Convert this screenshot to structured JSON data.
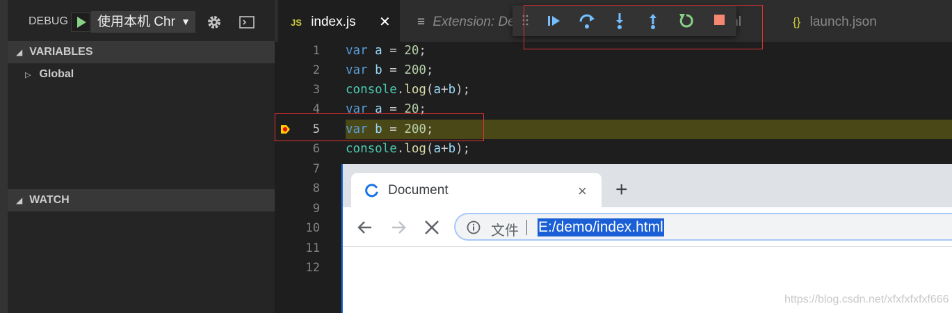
{
  "debug_toolbar": {
    "label": "DEBUG",
    "config_name": "使用本机 Chr",
    "icons": [
      "play-icon",
      "gear-icon",
      "console-icon"
    ]
  },
  "sidebar": {
    "variables_header": "VARIABLES",
    "variables_items": [
      {
        "label": "Global"
      }
    ],
    "watch_header": "WATCH"
  },
  "tabs": [
    {
      "label": "index.js",
      "icon": "JS",
      "active": true
    },
    {
      "label": "Extension: De",
      "icon": "≡",
      "active": false
    },
    {
      "label": "ml",
      "active": false
    },
    {
      "label": "launch.json",
      "icon": "{}",
      "active": false
    }
  ],
  "floating_toolbar": {
    "buttons": [
      "continue-icon",
      "step-over-icon",
      "step-into-icon",
      "step-out-icon",
      "restart-icon",
      "stop-icon"
    ]
  },
  "editor": {
    "line_numbers": [
      "1",
      "2",
      "3",
      "4",
      "5",
      "6",
      "7",
      "8",
      "9",
      "10",
      "11",
      "12"
    ],
    "current_line": 5,
    "lines": [
      "var a = 20;",
      "var b = 200;",
      "console.log(a+b);",
      "var a = 20;",
      "var b = 200;",
      "console.log(a+b);"
    ]
  },
  "browser": {
    "tab_title": "Document",
    "close_symbol": "×",
    "new_tab_symbol": "+",
    "address_prefix": "文件",
    "url": "E:/demo/index.html"
  },
  "watermark": "https://blog.csdn.net/xfxfxfxfxf666",
  "colors": {
    "highlight": "#4b4818",
    "annotation_box": "#e03030",
    "stop": "#f48771",
    "continue": "#75beff",
    "restart": "#89d185"
  }
}
